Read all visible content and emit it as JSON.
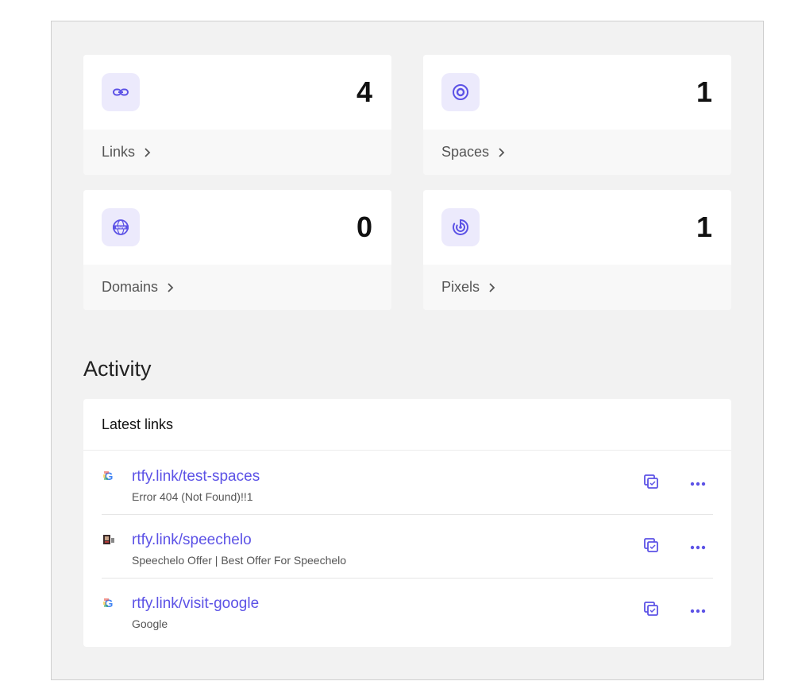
{
  "stats": [
    {
      "label": "Links",
      "count": "4",
      "icon": "link-icon"
    },
    {
      "label": "Spaces",
      "count": "1",
      "icon": "spaces-icon"
    },
    {
      "label": "Domains",
      "count": "0",
      "icon": "www-globe-icon"
    },
    {
      "label": "Pixels",
      "count": "1",
      "icon": "pixel-icon"
    }
  ],
  "activity": {
    "title": "Activity",
    "latest_header": "Latest links",
    "links": [
      {
        "url": "rtfy.link/test-spaces",
        "title": "Error 404 (Not Found)!!1",
        "favicon": "google-favicon"
      },
      {
        "url": "rtfy.link/speechelo",
        "title": "Speechelo Offer | Best Offer For Speechelo",
        "favicon": "speechelo-favicon"
      },
      {
        "url": "rtfy.link/visit-google",
        "title": "Google",
        "favicon": "google-favicon"
      }
    ]
  },
  "colors": {
    "accent": "#5c52e6",
    "icon_bg": "#eceafc",
    "panel_bg": "#f2f2f2"
  }
}
